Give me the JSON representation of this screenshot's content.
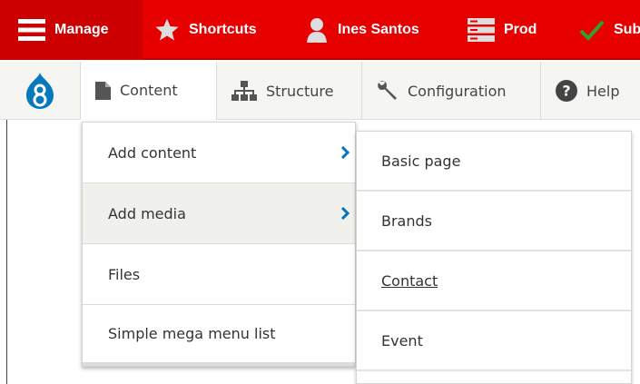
{
  "toolbar": {
    "manage_label": "Manage",
    "shortcuts_label": "Shortcuts",
    "user_label": "Ines Santos",
    "env_label": "Prod",
    "sub_label": "Sub",
    "bg_color": "#e60000",
    "active_bg_color": "#cc0000"
  },
  "tray": {
    "tabs": [
      {
        "label": "Content",
        "icon": "file-icon"
      },
      {
        "label": "Structure",
        "icon": "sitemap-icon"
      },
      {
        "label": "Configuration",
        "icon": "wrench-icon"
      },
      {
        "label": "Help",
        "icon": "question-icon"
      }
    ]
  },
  "menu_level1": {
    "items": [
      {
        "label": "Add content",
        "has_children": true
      },
      {
        "label": "Add media",
        "has_children": true,
        "active": true
      },
      {
        "label": "Files"
      },
      {
        "label": "Simple mega menu list"
      }
    ]
  },
  "menu_level2": {
    "items": [
      {
        "label": "Basic page"
      },
      {
        "label": "Brands"
      },
      {
        "label": "Contact",
        "hover": true
      },
      {
        "label": "Event"
      }
    ]
  },
  "colors": {
    "accent_blue": "#0074bd",
    "success_green": "#2ea12e"
  }
}
